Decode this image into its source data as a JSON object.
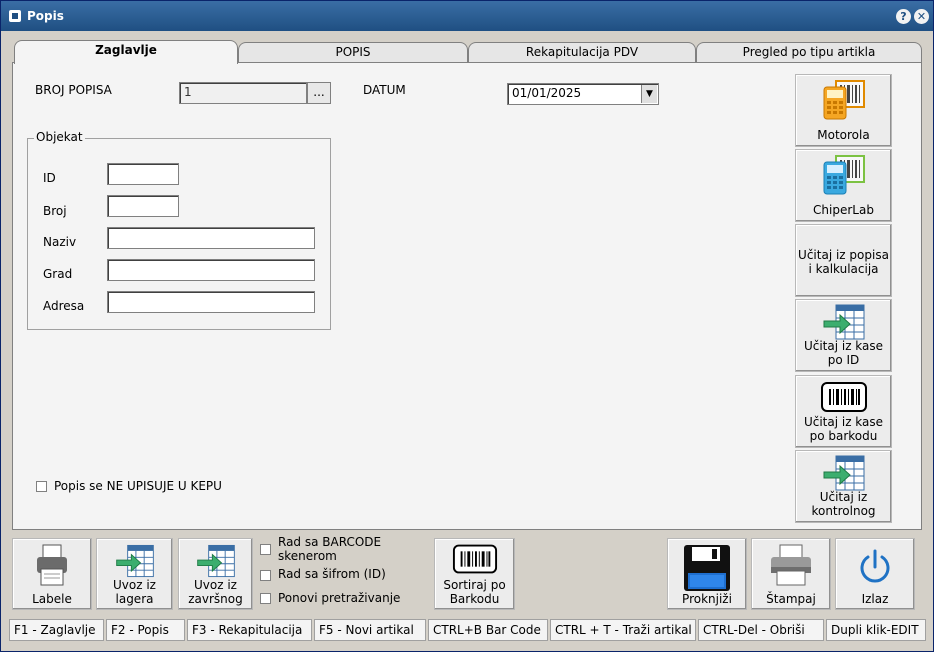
{
  "window": {
    "title": "Popis",
    "help_label": "?",
    "close_label": "✕"
  },
  "tabs": [
    {
      "label": "Zaglavlje",
      "active": true
    },
    {
      "label": "POPIS",
      "active": false
    },
    {
      "label": "Rekapitulacija PDV",
      "active": false
    },
    {
      "label": "Pregled po tipu artikla",
      "active": false
    }
  ],
  "header": {
    "broj_popisa_label": "BROJ POPISA",
    "broj_popisa_value": "1",
    "dots_label": "...",
    "datum_label": "DATUM",
    "datum_value": "01/01/2025"
  },
  "objekat": {
    "title": "Objekat",
    "fields": [
      {
        "label": "ID",
        "value": ""
      },
      {
        "label": "Broj",
        "value": ""
      },
      {
        "label": "Naziv",
        "value": ""
      },
      {
        "label": "Grad",
        "value": ""
      },
      {
        "label": "Adresa",
        "value": ""
      }
    ]
  },
  "kepu_checkbox": {
    "label": "Popis se NE UPISUJE U KEPU",
    "checked": false
  },
  "side_buttons": [
    {
      "label": "Motorola",
      "icon": "scanner-orange-icon"
    },
    {
      "label": "ChiperLab",
      "icon": "scanner-blue-icon"
    },
    {
      "label": "Učitaj iz popisa i kalkulacija",
      "icon": ""
    },
    {
      "label": "Učitaj iz kase po ID",
      "icon": "table-import-icon"
    },
    {
      "label": "Učitaj iz kase po barkodu",
      "icon": "barcode-icon"
    },
    {
      "label": "Učitaj iz kontrolnog",
      "icon": "table-import-icon"
    }
  ],
  "bottom_buttons": {
    "labele": "Labele",
    "uvoz_lager": "Uvoz iz lagera",
    "uvoz_zavrsnog": "Uvoz iz završnog",
    "sortiraj": "Sortiraj po Barkodu",
    "proknjizi": "Proknjiži",
    "stampaj": "Štampaj",
    "izlaz": "Izlaz"
  },
  "options": [
    {
      "label": "Rad sa BARCODE skenerom",
      "checked": false
    },
    {
      "label": "Rad sa šifrom (ID)",
      "checked": false
    },
    {
      "label": "Ponovi pretraživanje",
      "checked": false
    }
  ],
  "status_bar": [
    "F1 - Zaglavlje",
    "F2 - Popis",
    "F3 - Rekapitulacija",
    "F5 - Novi artikal",
    "CTRL+B Bar Code",
    "CTRL + T - Traži artikal",
    "CTRL-Del - Obriši",
    "Dupli klik-EDIT"
  ]
}
